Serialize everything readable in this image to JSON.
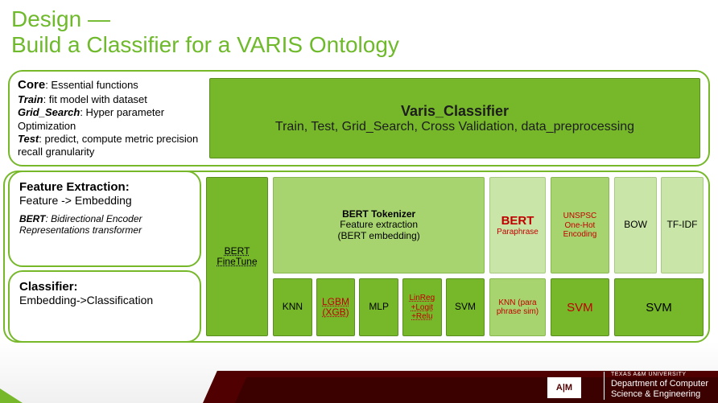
{
  "title_line1": "Design —",
  "title_line2": "Build a Classifier for a VARIS Ontology",
  "core": {
    "header": "Core",
    "header_tail": ": Essential functions",
    "train_lbl": "Train",
    "train_desc": ": fit model with dataset",
    "grid_lbl": "Grid_Search",
    "grid_desc": ": Hyper parameter Optimization",
    "test_lbl": "Test",
    "test_desc": ": predict, compute metric precision recall granularity",
    "block_title": "Varis_Classifier",
    "block_subtitle": "Train, Test, Grid_Search, Cross Validation, data_preprocessing"
  },
  "feat": {
    "header": "Feature Extraction:",
    "sub": "Feature -> Embedding",
    "desc_lbl": "BERT",
    "desc_txt": ": Bidirectional Encoder Representations transformer"
  },
  "cls": {
    "header": "Classifier:",
    "sub": "Embedding->Classification"
  },
  "cols": {
    "finetune": "BERT FineTune",
    "bert_top_b": "BERT Tokenizer",
    "bert_top_l1": "Feature extraction",
    "bert_top_l2": "(BERT embedding)",
    "bert_c1": "KNN",
    "bert_c2": "LGBM (XGB)",
    "bert_c3": "MLP",
    "bert_c4": "LinReg +Logit +Relu",
    "bert_c5": "SVM",
    "para_top1": "BERT",
    "para_top2": "Paraphrase",
    "para_bot": "KNN (para phrase sim)",
    "unspsc_top": "UNSPSC One-Hot Encoding",
    "unspsc_bot": "SVM",
    "bow_top": "BOW",
    "tfidf_top": "TF-IDF",
    "bow_tfidf_bot": "SVM"
  },
  "footer": {
    "logo": "A|M",
    "uni": "TEXAS A&M UNIVERSITY",
    "d1": "Department of Computer",
    "d2": "Science & Engineering"
  }
}
